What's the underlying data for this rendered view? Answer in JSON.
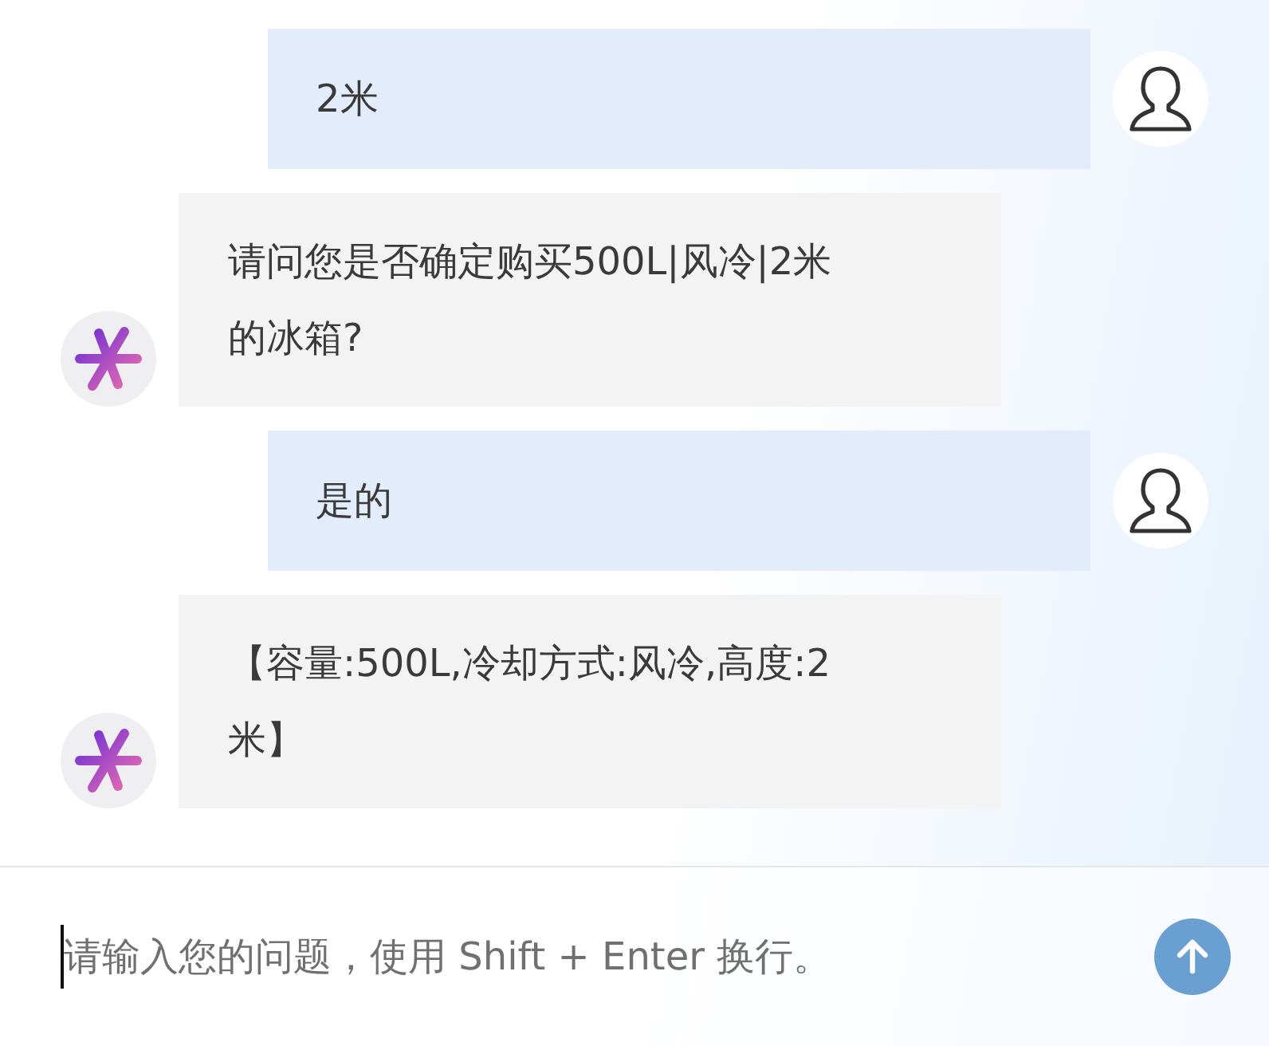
{
  "messages": [
    {
      "kind": "user",
      "text": "2米"
    },
    {
      "kind": "assistant",
      "text": "请问您是否确定购买500L|风冷|2米的冰箱?"
    },
    {
      "kind": "user",
      "text": "是的"
    },
    {
      "kind": "assistant",
      "text": "【容量:500L,冷却方式:风冷,高度:2米】"
    }
  ],
  "composer": {
    "placeholder": "请输入您的问题，使用 Shift + Enter 换行。"
  }
}
